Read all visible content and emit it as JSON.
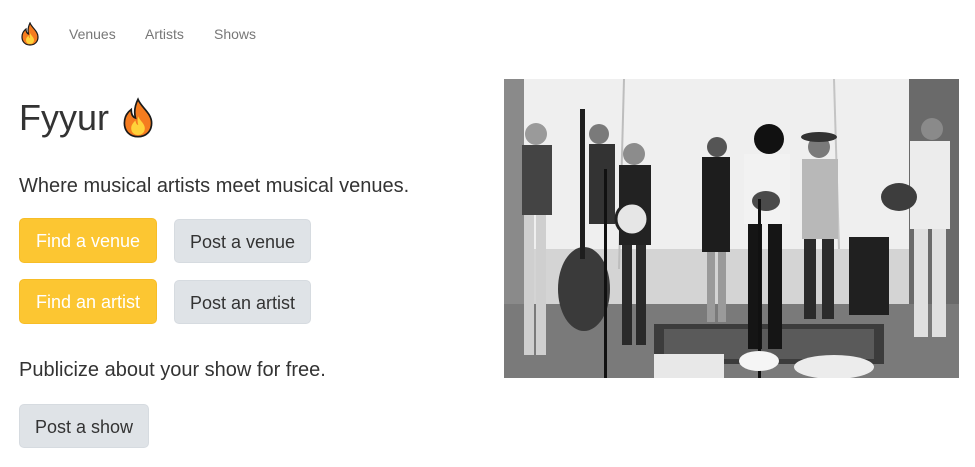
{
  "nav": {
    "brand_icon": "flame-icon",
    "links": [
      "Venues",
      "Artists",
      "Shows"
    ]
  },
  "hero": {
    "title": "Fyyur",
    "title_icon": "flame-icon",
    "lead": "Where musical artists meet musical venues.",
    "buttons": {
      "find_venue": "Find a venue",
      "post_venue": "Post a venue",
      "find_artist": "Find an artist",
      "post_artist": "Post an artist"
    },
    "publicize": "Publicize about your show for free.",
    "post_show": "Post a show"
  },
  "colors": {
    "primary_button": "#fcc632",
    "secondary_button": "#dfe3e7",
    "text": "#333333",
    "nav_text": "#777777"
  }
}
